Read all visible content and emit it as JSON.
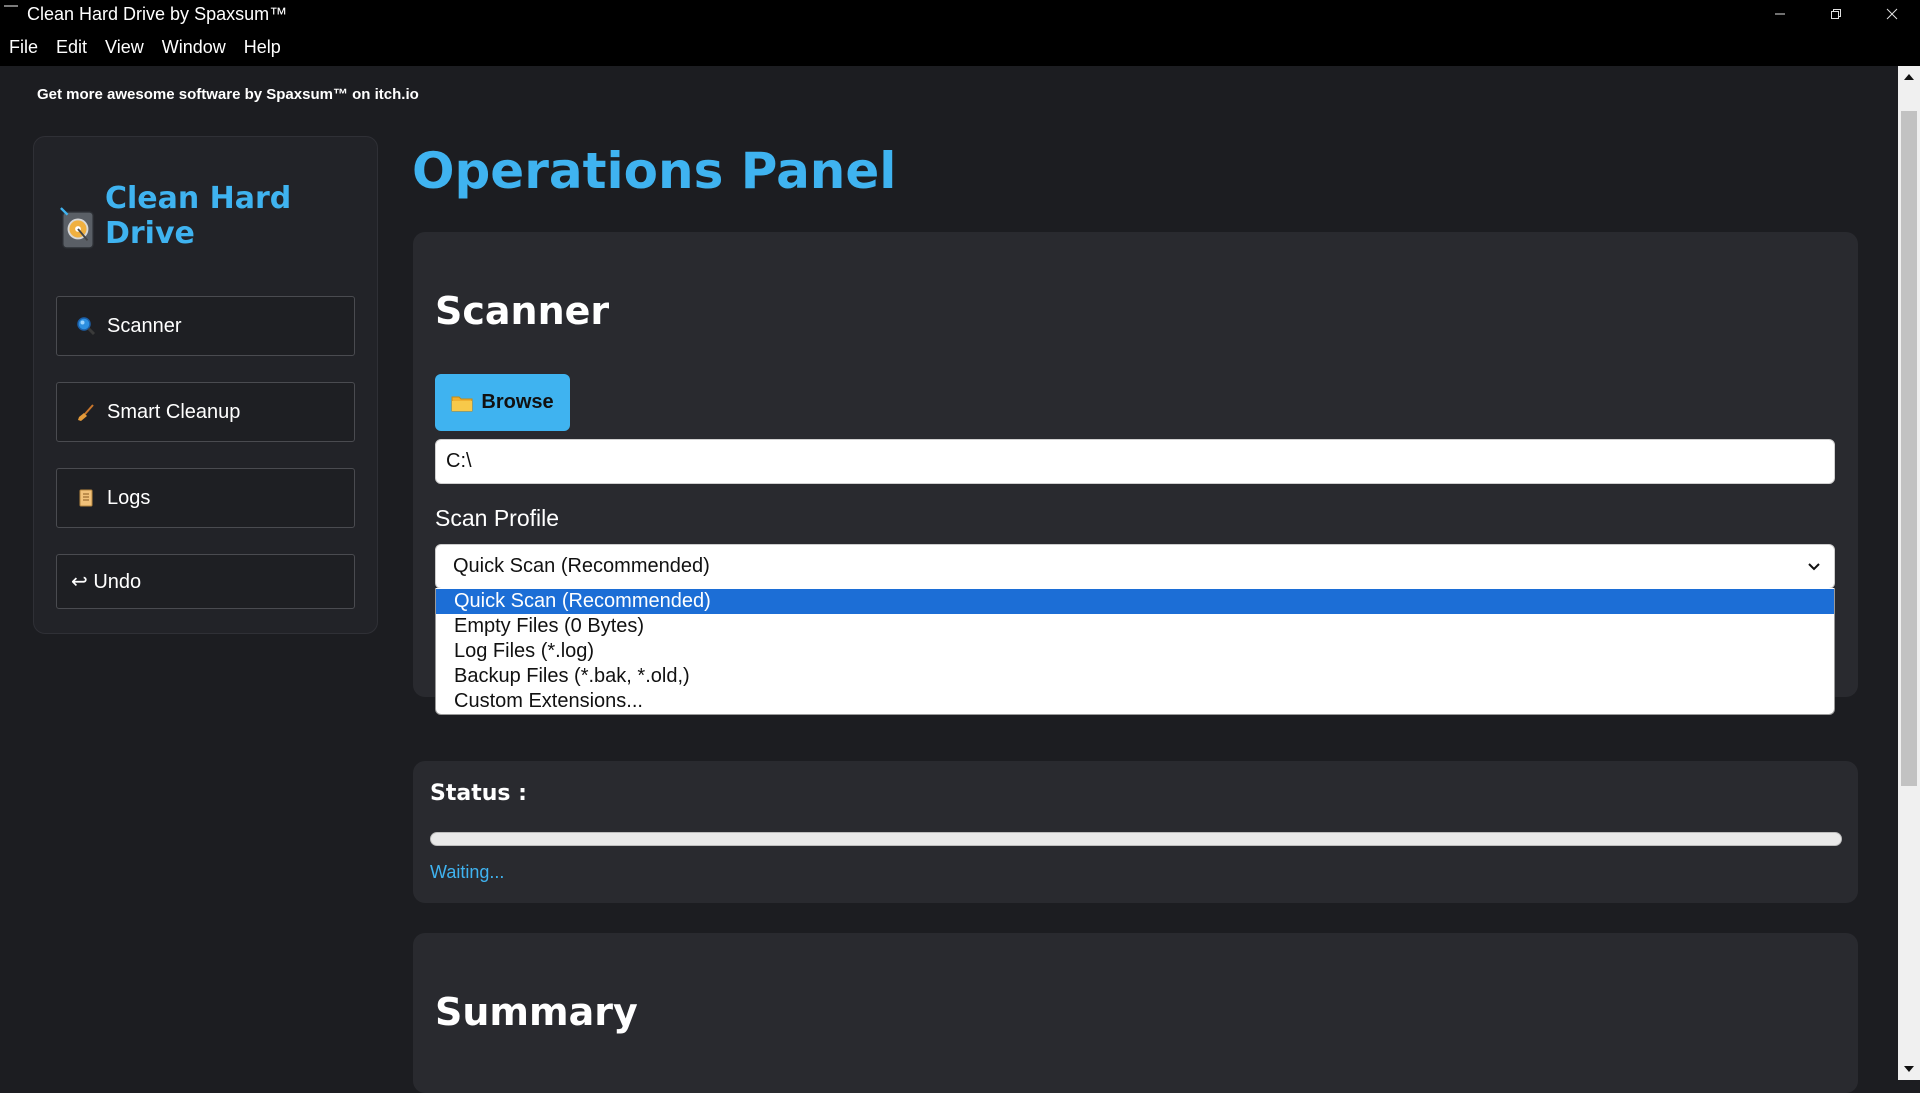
{
  "window": {
    "title": "Clean Hard Drive by Spaxsum™",
    "controls": [
      "minimize",
      "restore",
      "close"
    ]
  },
  "menu": [
    "File",
    "Edit",
    "View",
    "Window",
    "Help"
  ],
  "promo_text": "Get more awesome software by Spaxsum™ on itch.io",
  "sidebar": {
    "brand": "Clean Hard Drive",
    "items": [
      {
        "label": "Scanner",
        "icon": "magnifier-icon"
      },
      {
        "label": "Smart Cleanup",
        "icon": "broom-icon"
      },
      {
        "label": "Logs",
        "icon": "scroll-icon"
      },
      {
        "label": "↩ Undo",
        "icon": ""
      }
    ]
  },
  "main": {
    "title": "Operations Panel",
    "scanner": {
      "title": "Scanner",
      "browse_label": "Browse",
      "path_value": "C:\\",
      "profile_label": "Scan Profile",
      "profile_selected": "Quick Scan (Recommended)",
      "profile_options": [
        "Quick Scan (Recommended)",
        "Empty Files (0 Bytes)",
        "Log Files (*.log)",
        "Backup Files (*.bak, *.old,)",
        "Custom Extensions..."
      ]
    },
    "status": {
      "label": "Status :",
      "progress": 0,
      "text": "Waiting..."
    },
    "summary": {
      "title": "Summary"
    }
  },
  "colors": {
    "accent": "#3fb3f0",
    "background": "#1c1d21",
    "card": "#292a2f",
    "selected_option": "#1c6ed6"
  }
}
